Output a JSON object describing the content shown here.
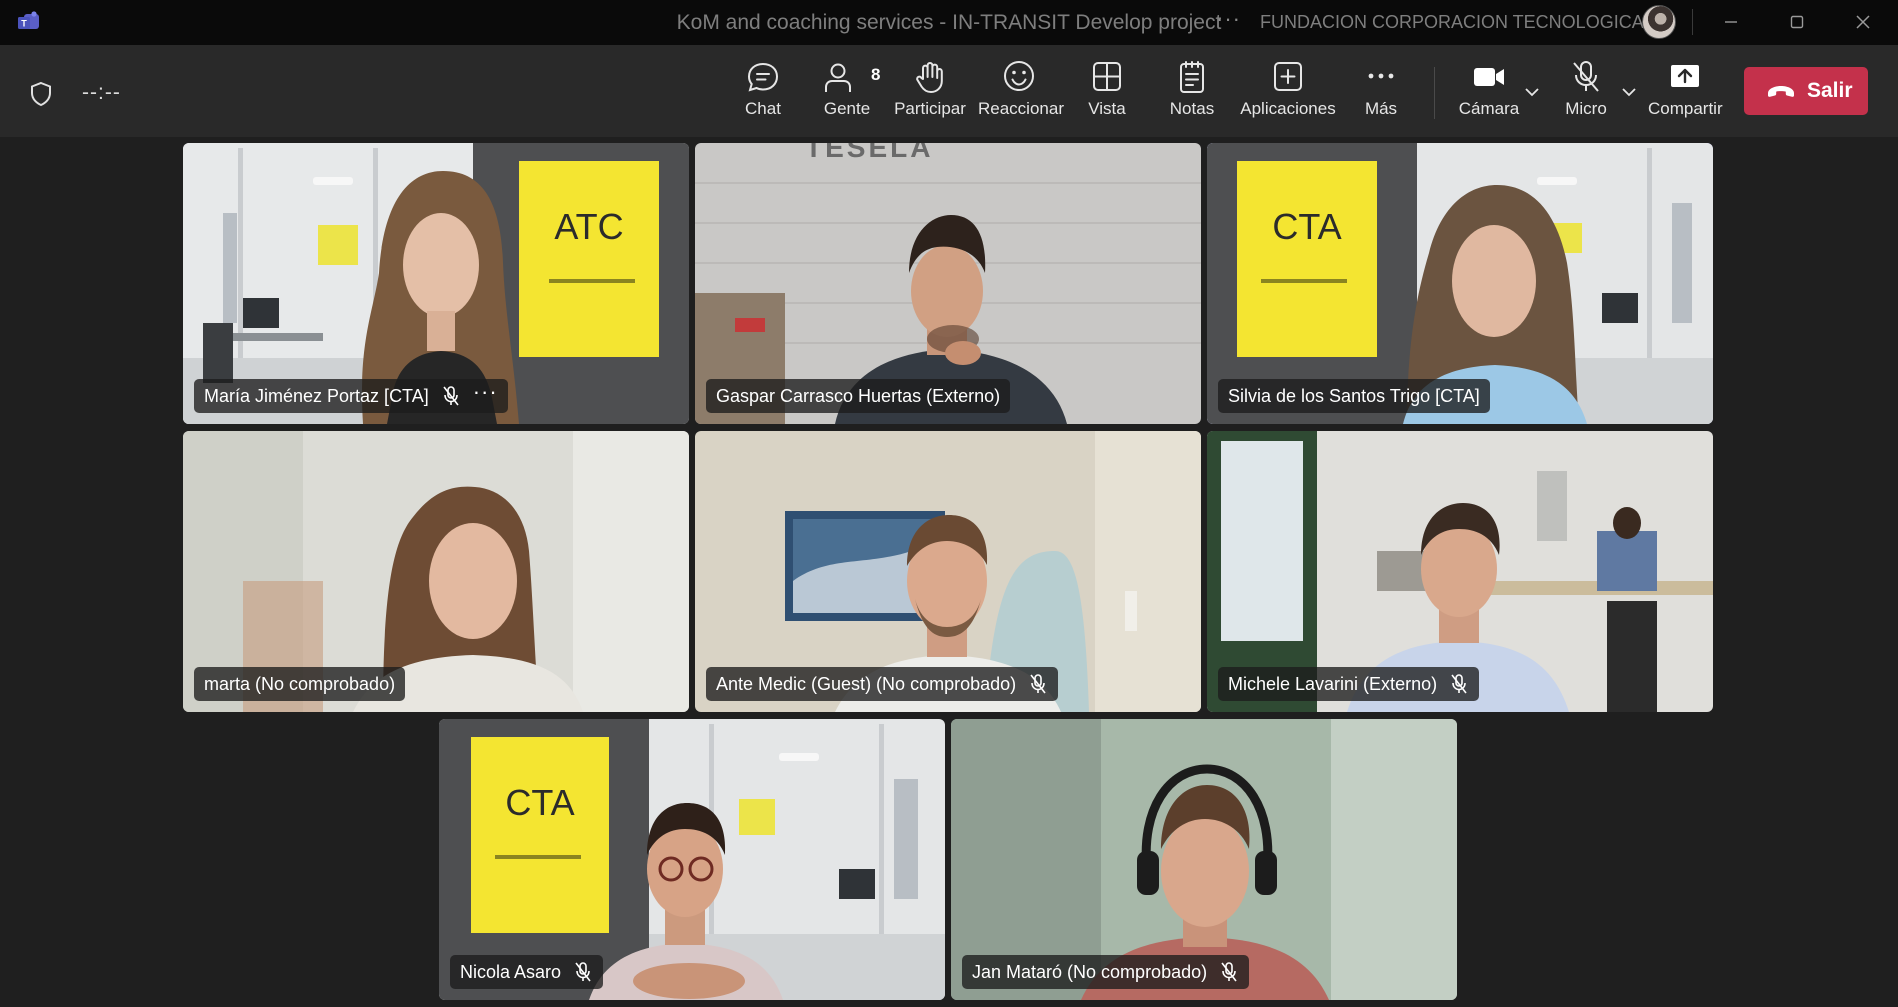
{
  "window": {
    "title": "KoM and coaching services - IN-TRANSIT Develop project",
    "org": "FUNDACION CORPORACION TECNOLOGICA A",
    "more": "···"
  },
  "toolbar": {
    "timer": "--:--",
    "chat": "Chat",
    "people": "Gente",
    "people_count": "8",
    "raise": "Participar",
    "react": "Reaccionar",
    "view": "Vista",
    "notes": "Notas",
    "apps": "Aplicaciones",
    "more": "Más",
    "camera": "Cámara",
    "mic": "Micro",
    "share": "Compartir",
    "leave": "Salir"
  },
  "participants": [
    {
      "name": "María Jiménez Portaz [CTA]",
      "muted": true,
      "more": "···"
    },
    {
      "name": "Gaspar Carrasco Huertas (Externo)",
      "muted": false
    },
    {
      "name": "Silvia de los Santos Trigo [CTA]",
      "muted": false,
      "active": true
    },
    {
      "name": "marta (No comprobado)",
      "muted": false
    },
    {
      "name": "Ante Medic (Guest) (No comprobado)",
      "muted": true
    },
    {
      "name": "Michele Lavarini (Externo)",
      "muted": true
    },
    {
      "name": "Nicola Asaro",
      "muted": true
    },
    {
      "name": "Jan Mataró (No comprobado)",
      "muted": true
    }
  ],
  "backgrounds": {
    "poster_text": "CTA",
    "poster_text_mirrored": "ATC",
    "wall_text": "TESELA"
  },
  "colors": {
    "leave": "#c4314b",
    "active_speaker": "#8b8cf7",
    "poster": "#f4e531"
  }
}
